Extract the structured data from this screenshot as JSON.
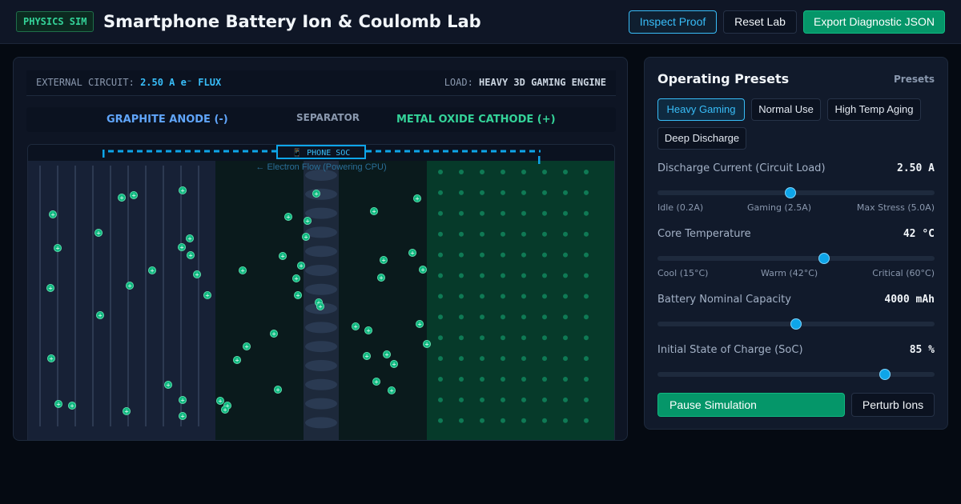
{
  "header": {
    "badge": "PHYSICS SIM",
    "title": "Smartphone Battery Ion & Coulomb Lab",
    "buttons": {
      "inspect": "Inspect Proof",
      "reset": "Reset Lab",
      "export": "Export Diagnostic JSON"
    }
  },
  "sim": {
    "external_label": "EXTERNAL CIRCUIT:",
    "external_value": "2.50 A e⁻ FLUX",
    "load_label": "LOAD:",
    "load_value": "HEAVY 3D GAMING ENGINE",
    "anode_label": "GRAPHITE ANODE (-)",
    "separator_label": "SEPARATOR",
    "cathode_label": "METAL OXIDE CATHODE (+)",
    "soc_label": "📱 PHONE SOC",
    "electron_flow": "← Electron Flow (Powering CPU)",
    "ion_symbol": "+",
    "colors": {
      "anode": "#60a5fa",
      "cathode": "#34d399",
      "wire": "#0ea5e9",
      "ion": "#10b981"
    }
  },
  "presets": {
    "title": "Operating Presets",
    "tag": "Presets",
    "items": [
      {
        "label": "Heavy Gaming",
        "active": true
      },
      {
        "label": "Normal Use",
        "active": false
      },
      {
        "label": "High Temp Aging",
        "active": false
      },
      {
        "label": "Deep Discharge",
        "active": false
      }
    ],
    "controls": {
      "current": {
        "label": "Discharge Current (Circuit Load)",
        "value": "2.50 A",
        "level": 0.48,
        "scale": [
          "Idle (0.2A)",
          "Gaming (2.5A)",
          "Max Stress (5.0A)"
        ]
      },
      "temperature": {
        "label": "Core Temperature",
        "value": "42 °C",
        "level": 0.6,
        "scale": [
          "Cool (15°C)",
          "Warm (42°C)",
          "Critical (60°C)"
        ]
      },
      "capacity": {
        "label": "Battery Nominal Capacity",
        "value": "4000 mAh",
        "level": 0.5
      },
      "soc": {
        "label": "Initial State of Charge (SoC)",
        "value": "85 %",
        "level": 0.82
      }
    },
    "pause_label": "Pause Simulation",
    "perturb_label": "Perturb Ions"
  }
}
